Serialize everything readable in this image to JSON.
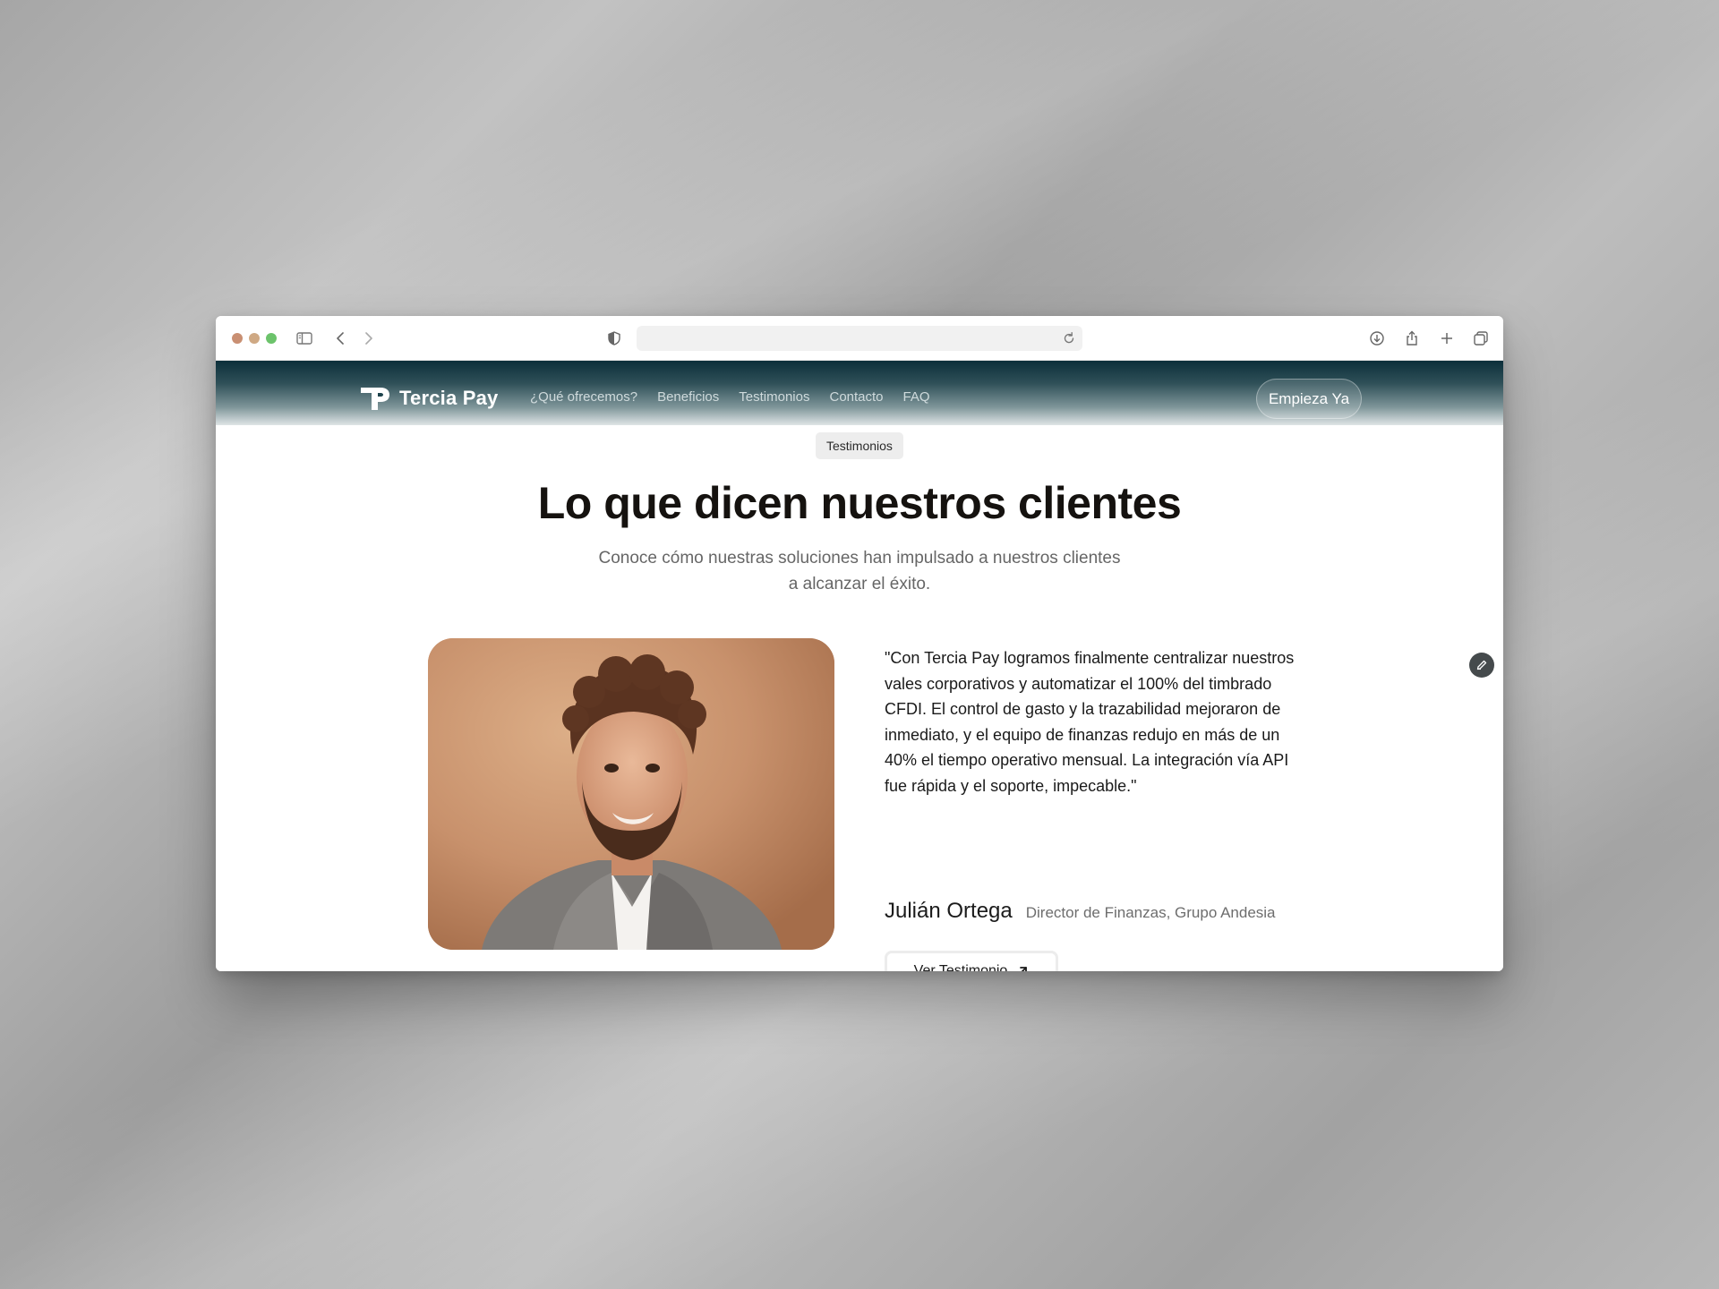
{
  "browser": {
    "address_value": ""
  },
  "site": {
    "brand": "Tercia Pay",
    "nav": [
      {
        "label": "¿Qué ofrecemos?"
      },
      {
        "label": "Beneficios"
      },
      {
        "label": "Testimonios"
      },
      {
        "label": "Contacto"
      },
      {
        "label": "FAQ"
      }
    ],
    "cta_label": "Empieza Ya"
  },
  "section": {
    "tag": "Testimonios",
    "title": "Lo que dicen nuestros clientes",
    "subtitle_line1": "Conoce cómo nuestras soluciones han impulsado a nuestros clientes",
    "subtitle_line2": "a alcanzar el éxito."
  },
  "testimonial": {
    "quote": "\"Con Tercia Pay logramos finalmente centralizar nuestros vales corporativos y automatizar el 100% del timbrado CFDI. El control de gasto y la trazabilidad mejoraron de inmediato, y el equipo de finanzas redujo en más de un 40% el tiempo operativo mensual. La integración vía API fue rápida y el soporte, impecable.\"",
    "author_name": "Julián Ortega",
    "author_role": "Director de Finanzas, Grupo Andesia",
    "button_label": "Ver Testimonio"
  },
  "icons": {
    "sidebar": "sidebar-icon",
    "back": "chevron-left-icon",
    "forward": "chevron-right-icon",
    "privacy": "shield-icon",
    "reload": "reload-icon",
    "download": "download-icon",
    "share": "share-icon",
    "new_tab": "plus-icon",
    "tabs": "tabs-overview-icon",
    "arrow": "arrow-up-right-icon",
    "edit": "pencil-icon"
  },
  "colors": {
    "header_dark": "#0c2f3a",
    "heading": "#15120f",
    "traffic_red": "#c98f72",
    "traffic_yellow": "#cfa984",
    "traffic_green": "#6cc36b"
  }
}
